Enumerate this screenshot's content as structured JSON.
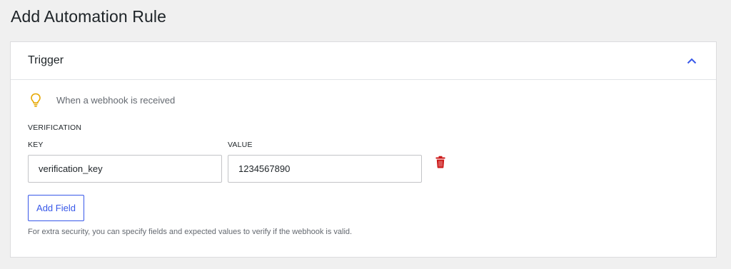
{
  "page": {
    "title": "Add Automation Rule"
  },
  "trigger_card": {
    "title": "Trigger",
    "collapse_icon": "chevron-up-icon",
    "trigger_icon": "lightbulb-icon",
    "trigger_text": "When a webhook is received",
    "verification": {
      "section_label": "VERIFICATION",
      "key_label": "KEY",
      "value_label": "VALUE",
      "fields": [
        {
          "key": "verification_key",
          "value": "1234567890"
        }
      ],
      "delete_icon": "trash-icon",
      "add_field_label": "Add Field",
      "help_text": "For extra security, you can specify fields and expected values to verify if the webhook is valid."
    }
  },
  "colors": {
    "accent": "#3858e9",
    "bulb": "#e6a700",
    "danger": "#cc1818",
    "background": "#f0f0f0"
  }
}
